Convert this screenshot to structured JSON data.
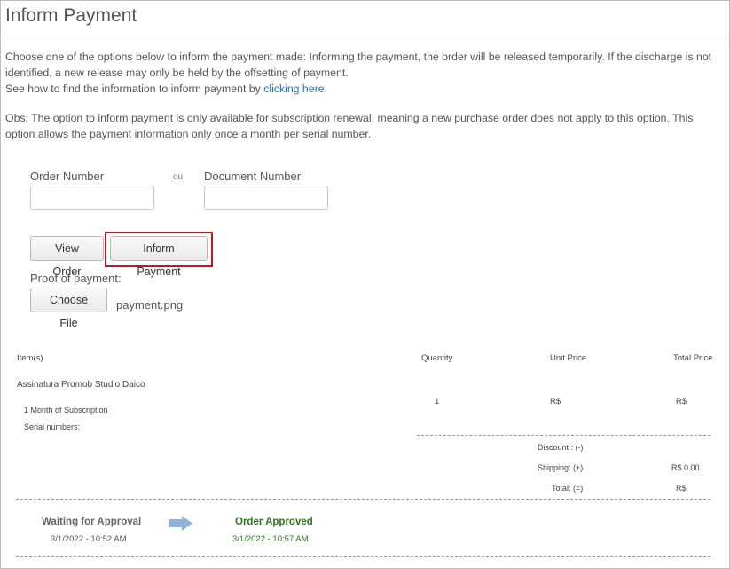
{
  "page": {
    "title": "Inform Payment",
    "instructions": "Choose one of the options below to inform the payment made: Informing the payment, the order will be released temporarily. If the discharge is not identified, a new release may only be held by the offsetting of payment.",
    "help_prefix": "See how to find the information to inform payment by ",
    "help_link": "clicking here",
    "help_suffix": ".",
    "obs": "Obs: The option to inform payment is only available for subscription renewal, meaning a new purchase order does not apply to this option. This option allows the payment information only once a month per serial number."
  },
  "form": {
    "order_number_label": "Order Number",
    "ou_label": "ou",
    "document_number_label": "Document Number",
    "order_number_value": "",
    "document_number_value": "",
    "view_order_button": "View Order",
    "inform_payment_button": "Inform Payment",
    "proof_label": "Proof of payment:",
    "choose_file_button": "Choose File",
    "file_name": "payment.png"
  },
  "order_table": {
    "headers": {
      "items": "Item(s)",
      "quantity": "Quantity",
      "unit_price": "Unit Price",
      "total_price": "Total Price"
    },
    "product_name": "Assinatura Promob Studio Daico",
    "product_detail": "1 Month of Subscription",
    "serial_label": "Serial numbers:",
    "quantity": "1",
    "unit_price": "R$",
    "total_price": "R$",
    "discount_label": "Discount : (-)",
    "shipping_label": "Shipping: (+)",
    "shipping_value": "R$ 0.00",
    "total_label": "Total: (=)",
    "total_value": "R$"
  },
  "status": {
    "step1_label": "Waiting for Approval",
    "step1_date": "3/1/2022 - 10:52 AM",
    "step2_label": "Order Approved",
    "step2_date": "3/1/2022 - 10:57 AM",
    "arrow_icon": "arrow-right-icon",
    "colors": {
      "approved": "#2a7a1a",
      "arrow": "#8fb3d9",
      "highlight": "#d0101a",
      "link": "#1a73c8"
    }
  }
}
